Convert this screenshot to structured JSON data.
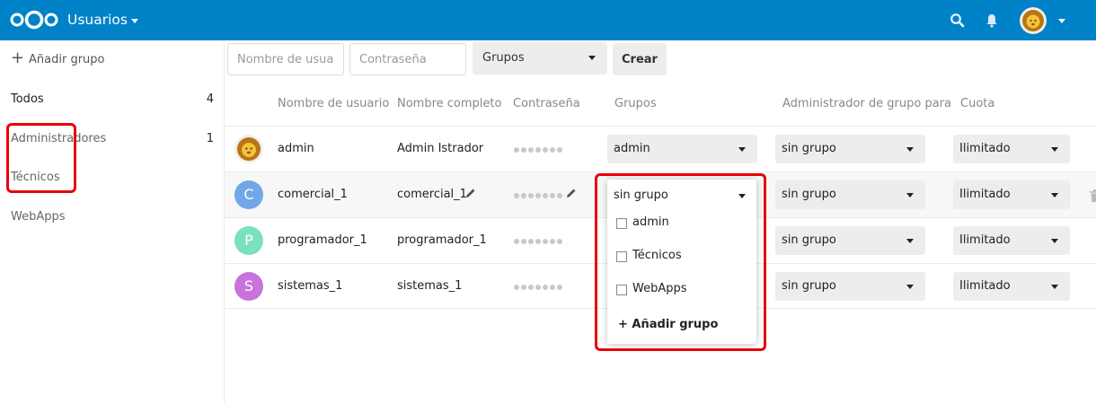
{
  "header": {
    "app_title": "Usuarios",
    "icons": [
      "nextcloud-logo",
      "search-icon",
      "notifications-icon",
      "user-avatar",
      "chevron-down-icon"
    ],
    "background_color": "#0082c9"
  },
  "sidebar": {
    "add_group": "Añadir grupo",
    "groups": [
      {
        "label": "Todos",
        "count": "4"
      },
      {
        "label": "Administradores",
        "count": "1"
      },
      {
        "label": "Técnicos",
        "count": ""
      },
      {
        "label": "WebApps",
        "count": ""
      }
    ]
  },
  "create_bar": {
    "username_placeholder": "Nombre de usuar",
    "password_placeholder": "Contraseña",
    "groups_label": "Grupos",
    "create_label": "Crear"
  },
  "table": {
    "headers": [
      "Nombre de usuario",
      "Nombre completo",
      "Contraseña",
      "Grupos",
      "Administrador de grupo para",
      "Cuota"
    ],
    "rows": [
      {
        "avatar": "lion",
        "avatar_letter": "",
        "avatar_color": "",
        "username": "admin",
        "fullname": "Admin Istrador",
        "groups": "admin",
        "admin_of": "sin grupo",
        "quota": "Ilimitado"
      },
      {
        "avatar": "letter",
        "avatar_letter": "C",
        "avatar_color": "#71a7e6",
        "username": "comercial_1",
        "fullname": "comercial_1",
        "groups": "sin grupo",
        "admin_of": "sin grupo",
        "quota": "Ilimitado"
      },
      {
        "avatar": "letter",
        "avatar_letter": "P",
        "avatar_color": "#7be0bf",
        "username": "programador_1",
        "fullname": "programador_1",
        "groups": "",
        "admin_of": "sin grupo",
        "quota": "Ilimitado"
      },
      {
        "avatar": "letter",
        "avatar_letter": "S",
        "avatar_color": "#c873dc",
        "username": "sistemas_1",
        "fullname": "sistemas_1",
        "groups": "",
        "admin_of": "sin grupo",
        "quota": "Ilimitado"
      }
    ]
  },
  "groups_dropdown": {
    "selected": "sin grupo",
    "options": [
      "admin",
      "Técnicos",
      "WebApps"
    ],
    "add_group": "+ Añadir grupo"
  },
  "highlight_color": "#e8000b"
}
